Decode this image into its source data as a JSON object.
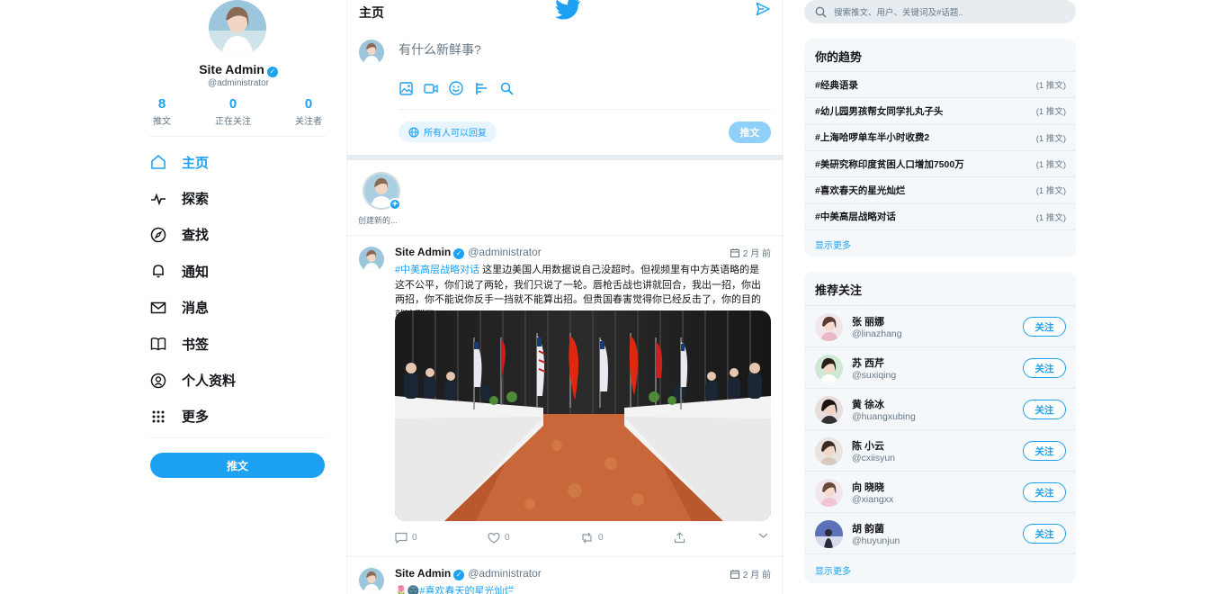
{
  "profile": {
    "name": "Site Admin",
    "handle": "@administrator",
    "stats": [
      {
        "num": "8",
        "label": "推文"
      },
      {
        "num": "0",
        "label": "正在关注"
      },
      {
        "num": "0",
        "label": "关注者"
      }
    ]
  },
  "nav": [
    {
      "label": "主页",
      "icon": "home-icon"
    },
    {
      "label": "探索",
      "icon": "pulse-icon"
    },
    {
      "label": "查找",
      "icon": "compass-icon"
    },
    {
      "label": "通知",
      "icon": "bell-icon"
    },
    {
      "label": "消息",
      "icon": "mail-icon"
    },
    {
      "label": "书签",
      "icon": "book-icon"
    },
    {
      "label": "个人资料",
      "icon": "user-circle-icon"
    },
    {
      "label": "更多",
      "icon": "grid-icon"
    }
  ],
  "left_tweet_button": "推文",
  "header": {
    "title": "主页"
  },
  "compose": {
    "placeholder": "有什么新鲜事?",
    "reply_setting": "所有人可以回复",
    "tweet_button": "推文"
  },
  "stories": {
    "create_label": "创建新的..."
  },
  "tweets": [
    {
      "name": "Site Admin",
      "handle": "@administrator",
      "time": "2 月 前",
      "hashtag": "#中美高层战略对话",
      "text": " 这里边美国人用数据说自己没超时。但视频里有中方英语略的是这不公平，你们说了两轮，我们只说了一轮。唇枪舌战也讲就回合，我出一招，你出两招，你不能说你反手一挡就不能算出招。但贵国春害觉得你已经反击了，你的目的就达到了。",
      "actions": {
        "comments": "0",
        "likes": "0",
        "retweets": "0"
      }
    },
    {
      "name": "Site Admin",
      "handle": "@administrator",
      "time": "2 月 前",
      "hashtag": "#喜欢春天的星光灿烂"
    }
  ],
  "search": {
    "placeholder": "搜索推文、用户、关键词及#话题.."
  },
  "trends": {
    "title": "你的趋势",
    "items": [
      {
        "tag": "#经典语录",
        "count": "(1 推文)"
      },
      {
        "tag": "#幼儿园男孩帮女同学扎丸子头",
        "count": "(1 推文)"
      },
      {
        "tag": "#上海哈啰单车半小时收费2",
        "count": "(1 推文)"
      },
      {
        "tag": "#美研究称印度贫困人口增加7500万",
        "count": "(1 推文)"
      },
      {
        "tag": "#喜欢春天的星光灿烂",
        "count": "(1 推文)"
      },
      {
        "tag": "#中美高层战略对话",
        "count": "(1 推文)"
      }
    ],
    "more": "显示更多"
  },
  "follow": {
    "title": "推荐关注",
    "items": [
      {
        "name": "张 丽娜",
        "handle": "@linazhang",
        "button": "关注"
      },
      {
        "name": "苏 西芹",
        "handle": "@suxiqing",
        "button": "关注"
      },
      {
        "name": "黄 徐冰",
        "handle": "@huangxubing",
        "button": "关注"
      },
      {
        "name": "陈 小云",
        "handle": "@cxiisyun",
        "button": "关注"
      },
      {
        "name": "向 晓晓",
        "handle": "@xiangxx",
        "button": "关注"
      },
      {
        "name": "胡 韵菌",
        "handle": "@huyunjun",
        "button": "关注"
      }
    ],
    "more": "显示更多"
  },
  "colors": {
    "accent": "#1da1f2",
    "text": "#14171a",
    "muted": "#657786",
    "panel": "#f5f8fa"
  }
}
